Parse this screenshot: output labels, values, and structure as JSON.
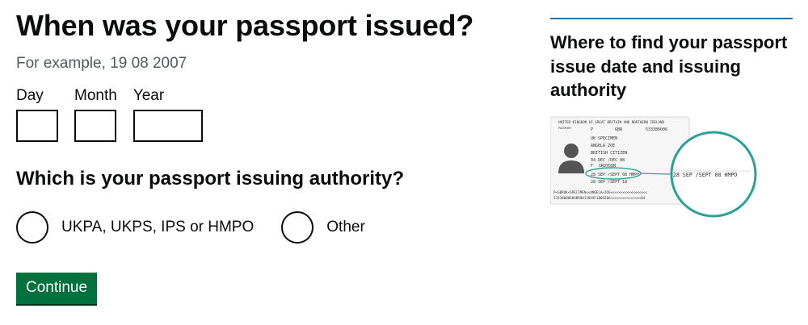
{
  "question": {
    "title": "When was your passport issued?",
    "hint": "For example, 19 08 2007"
  },
  "date": {
    "day_label": "Day",
    "month_label": "Month",
    "year_label": "Year",
    "day_value": "",
    "month_value": "",
    "year_value": ""
  },
  "authority": {
    "title": "Which is your passport issuing authority?",
    "options": [
      {
        "label": "UKPA, UKPS, IPS or HMPO",
        "selected": false
      },
      {
        "label": "Other",
        "selected": false
      }
    ]
  },
  "actions": {
    "continue_label": "Continue"
  },
  "aside": {
    "title": "Where to find your passport issue date and issuing authority",
    "passport": {
      "header": "UNITED KINGDOM OF GREAT BRITAIN AND NORTHERN IRELAND",
      "type": "P",
      "code": "GBR",
      "number": "533380006",
      "surname": "UK SPECIMEN",
      "given": "ANGELA ZOE",
      "nationality": "BRITISH CITIZEN",
      "dob": "04 DEC /DEC 88",
      "sex": "F",
      "place": "CROYDON",
      "issue": "28 SEP /SEPT 08 HMPO",
      "expiry": "28 SEP /SEPT 18",
      "mrz1": "P<GBRUK<SPECIMEN<<ANGELA<ZOE<<<<<<<<<<<<<<<<<<",
      "mrz2": "5333800068GBR8812049F1809286<<<<<<<<<<<<<<<04",
      "zoom": "28 SEP /SEPT 08 HMPO"
    },
    "colors": {
      "accent": "#1d70b8",
      "highlight": "#28a197",
      "button": "#00703c"
    }
  }
}
